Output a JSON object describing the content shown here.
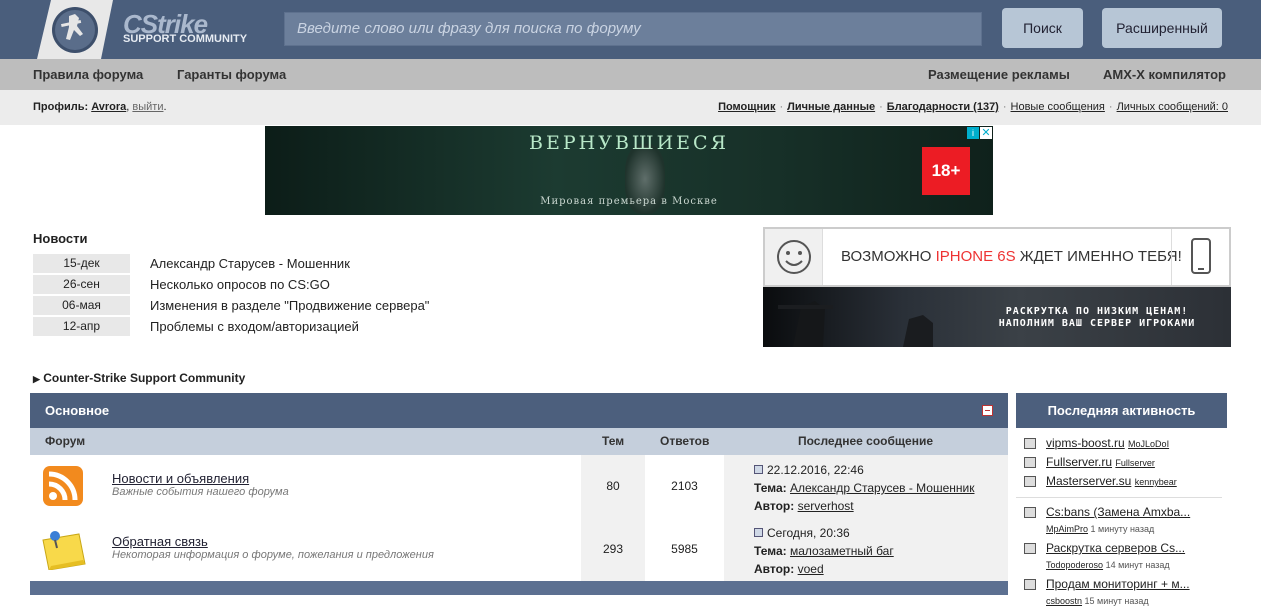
{
  "header": {
    "logo_title": "CStrike",
    "logo_sub": "SUPPORT COMMUNITY",
    "search_placeholder": "Введите слово или фразу для поиска по форуму",
    "search_btn": "Поиск",
    "advanced_btn": "Расширенный"
  },
  "nav": {
    "rules": "Правила форума",
    "guarantors": "Гаранты форума",
    "ads": "Размещение рекламы",
    "amx": "AMX-X компилятор"
  },
  "profile": {
    "label": "Профиль:",
    "user": "Avrora",
    "logout": "выйти",
    "helper": "Помощник",
    "personal": "Личные данные",
    "thanks": "Благодарности (137)",
    "new_msgs": "Новые сообщения",
    "pm": "Личных сообщений: 0"
  },
  "banner": {
    "title": "ВЕРНУВШИЕСЯ",
    "subtitle": "Мировая премьера в Москве",
    "age": "18+"
  },
  "news": {
    "heading": "Новости",
    "items": [
      {
        "date": "15-дек",
        "title": "Александр Старусев - Мошенник"
      },
      {
        "date": "26-сен",
        "title": "Несколько опросов по CS:GO"
      },
      {
        "date": "06-мая",
        "title": "Изменения в разделе \"Продвижение сервера\""
      },
      {
        "date": "12-апр",
        "title": "Проблемы с входом/авторизацией"
      }
    ]
  },
  "ad1": {
    "text_a": "ВОЗМОЖНО ",
    "text_b": "IPHONE 6S",
    "text_c": " ЖДЕТ ИМЕННО ТЕБЯ!"
  },
  "ad2": {
    "line1": "РАСКРУТКА ПО НИЗКИМ ЦЕНАМ!",
    "line2": "НАПОЛНИМ ВАШ СЕРВЕР ИГРОКАМИ"
  },
  "crumb": "Counter-Strike Support Community",
  "main": {
    "title": "Основное",
    "cols": {
      "forum": "Форум",
      "topics": "Тем",
      "answers": "Ответов",
      "last": "Последнее сообщение"
    },
    "rows": [
      {
        "title": "Новости и объявления",
        "desc": "Важные события нашего форума",
        "topics": "80",
        "answers": "2103",
        "date": "22.12.2016, 22:46",
        "theme_label": "Тема:",
        "theme": "Александр Старусев - Мошенник",
        "author_label": "Автор:",
        "author": "serverhost"
      },
      {
        "title": "Обратная связь",
        "desc": "Некоторая информация о форуме, пожелания и предложения",
        "topics": "293",
        "answers": "5985",
        "date": "Сегодня, 20:36",
        "theme_label": "Тема:",
        "theme": "малозаметный баг",
        "author_label": "Автор:",
        "author": "voed"
      }
    ]
  },
  "side": {
    "title": "Последняя активность",
    "top": [
      {
        "link": "vipms-boost.ru",
        "user": "MoJLoDoI"
      },
      {
        "link": "Fullserver.ru",
        "user": "Fullserver"
      },
      {
        "link": "Masterserver.su",
        "user": "kennybear"
      }
    ],
    "recent": [
      {
        "link": "Cs:bans (Замена Amxba...",
        "user": "MpAimPro",
        "time": "1 минуту назад"
      },
      {
        "link": "Раскрутка серверов Cs...",
        "user": "Todopoderoso",
        "time": "14 минут назад"
      },
      {
        "link": "Продам мониторинг + м...",
        "user": "csboostn",
        "time": "15 минут назад"
      }
    ]
  }
}
